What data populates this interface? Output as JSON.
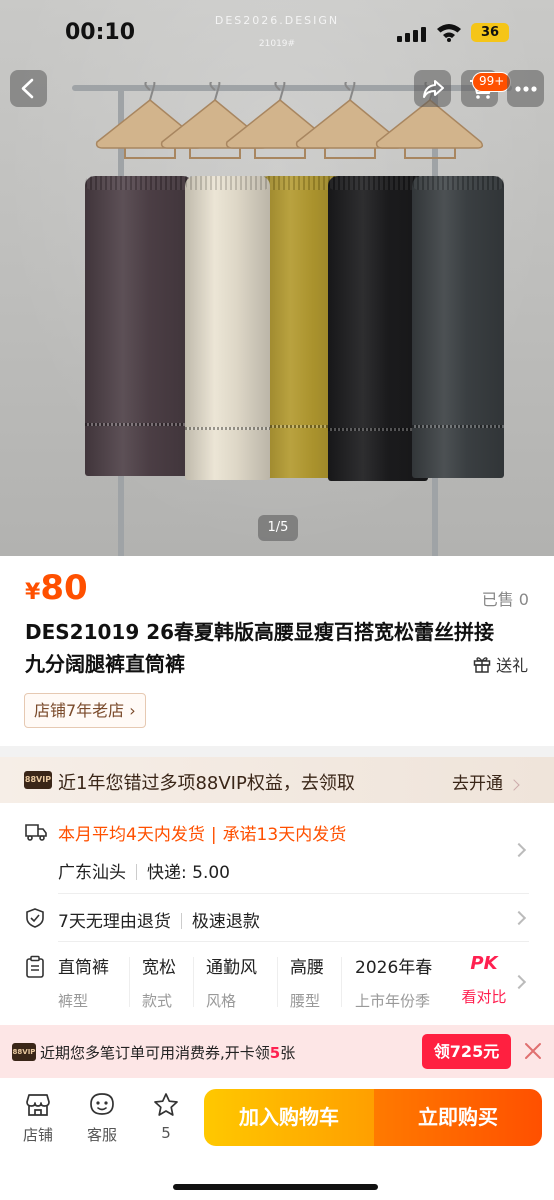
{
  "status_bar": {
    "time": "00:10",
    "battery": "36"
  },
  "hero": {
    "watermark_brand": "DES2026.DESIGN",
    "watermark_code": "21019#",
    "image_counter": "1/5",
    "cart_badge": "99+",
    "pants_colors": [
      "#4f4148",
      "#eae3d2",
      "#b39a2f",
      "#1c1c1e",
      "#3d4245"
    ]
  },
  "product": {
    "currency": "¥",
    "price": "80",
    "sold": "已售 0",
    "title": "DES21019 26春夏韩版高腰显瘦百搭宽松蕾丝拼接九分阔腿裤直筒裤",
    "gift": "送礼",
    "shop_tag": "店铺7年老店",
    "shop_tag_chevron": "›"
  },
  "vip_banner": {
    "logo": "88VIP",
    "text": "近1年您错过多项88VIP权益，去领取",
    "action": "去开通"
  },
  "service": {
    "ship_avg": "本月平均4天内发货",
    "ship_sep": "|",
    "ship_promise": "承诺13天内发货",
    "origin": "广东汕头",
    "express": "快递: 5.00",
    "return_policy": "7天无理由退货",
    "refund": "极速退款",
    "attributes": [
      {
        "value": "直筒裤",
        "key": "裤型"
      },
      {
        "value": "宽松",
        "key": "款式"
      },
      {
        "value": "通勤风",
        "key": "风格"
      },
      {
        "value": "高腰",
        "key": "腰型"
      },
      {
        "value": "2026年春",
        "key": "上市年份季"
      }
    ],
    "pk_logo": "PK",
    "pk_label": "看对比"
  },
  "coupon_bar": {
    "logo": "88VIP",
    "text_pre": "近期您多笔订单可用消费券,开卡领",
    "count": "5",
    "text_post": "张",
    "button": "领725元"
  },
  "bottom_bar": {
    "shop": "店铺",
    "service": "客服",
    "favorites": "5",
    "add_to_cart": "加入购物车",
    "buy_now": "立即购买"
  },
  "colors": {
    "accent": "#ff5000",
    "coupon_red": "#ff2040",
    "cart_yellow": "#ffc800"
  }
}
